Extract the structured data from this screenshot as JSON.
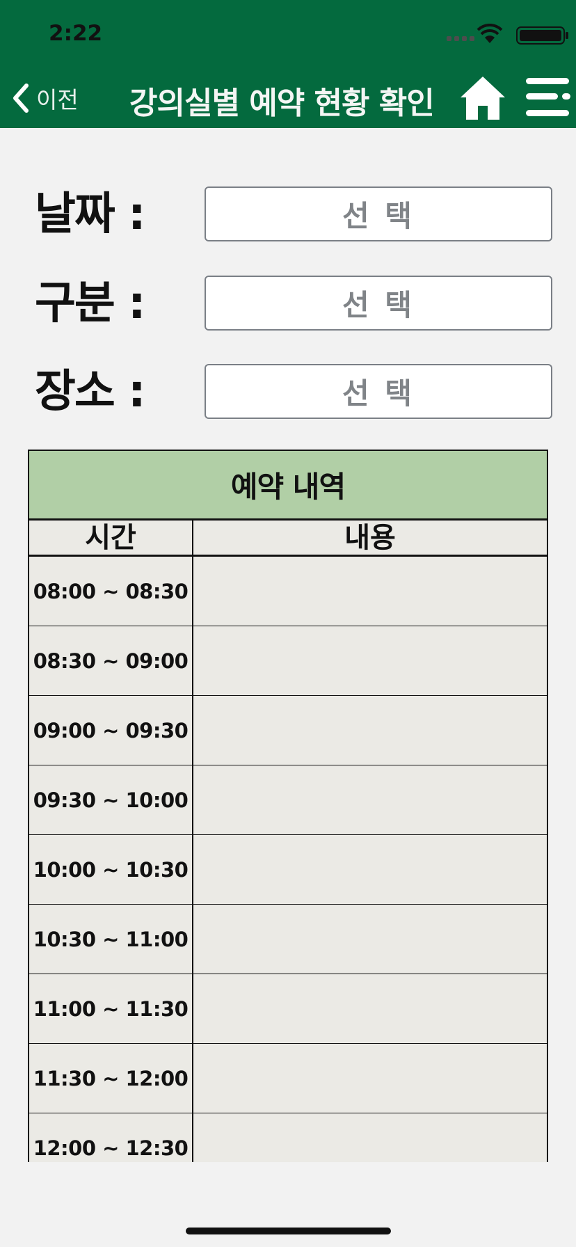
{
  "status_bar": {
    "time": "2:22"
  },
  "nav": {
    "back_label": "이전",
    "title": "강의실별 예약 현황 확인"
  },
  "form": {
    "date": {
      "label": "날짜 :",
      "value": "선 택"
    },
    "category": {
      "label": "구분 :",
      "value": "선 택"
    },
    "place": {
      "label": "장소 :",
      "value": "선 택"
    }
  },
  "table": {
    "title": "예약 내역",
    "col_time": "시간",
    "col_content": "내용",
    "rows": [
      {
        "time": "08:00 ~ 08:30",
        "content": ""
      },
      {
        "time": "08:30 ~ 09:00",
        "content": ""
      },
      {
        "time": "09:00 ~ 09:30",
        "content": ""
      },
      {
        "time": "09:30 ~ 10:00",
        "content": ""
      },
      {
        "time": "10:00 ~ 10:30",
        "content": ""
      },
      {
        "time": "10:30 ~ 11:00",
        "content": ""
      },
      {
        "time": "11:00 ~ 11:30",
        "content": ""
      },
      {
        "time": "11:30 ~ 12:00",
        "content": ""
      },
      {
        "time": "12:00 ~ 12:30",
        "content": ""
      }
    ]
  },
  "colors": {
    "header_bg": "#046a3e",
    "table_header_bg": "#b1cfa6",
    "table_cell_bg": "#ebeae5",
    "page_bg": "#f2f2f2"
  },
  "icons": [
    "chevron-left-icon",
    "home-icon",
    "menu-icon",
    "wifi-icon",
    "battery-icon"
  ]
}
